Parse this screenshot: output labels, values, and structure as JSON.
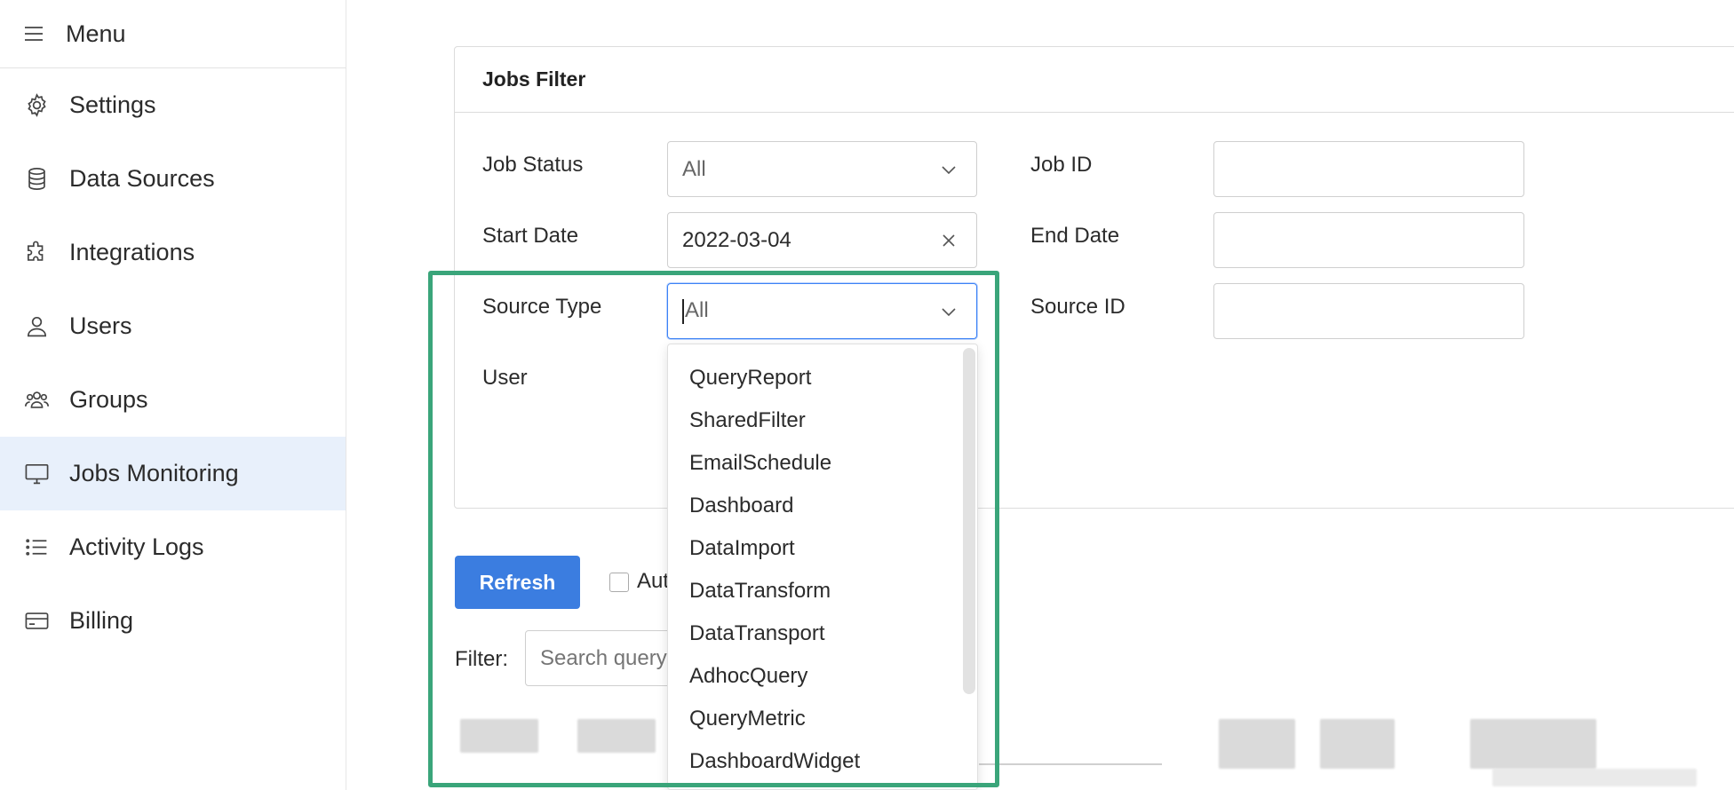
{
  "sidebar": {
    "menu_title": "Menu",
    "items": [
      {
        "label": "Settings",
        "icon": "gear-icon"
      },
      {
        "label": "Data Sources",
        "icon": "database-icon"
      },
      {
        "label": "Integrations",
        "icon": "puzzle-icon"
      },
      {
        "label": "Users",
        "icon": "user-icon"
      },
      {
        "label": "Groups",
        "icon": "users-group-icon"
      },
      {
        "label": "Jobs Monitoring",
        "icon": "monitor-icon",
        "active": true
      },
      {
        "label": "Activity Logs",
        "icon": "list-icon"
      },
      {
        "label": "Billing",
        "icon": "credit-card-icon"
      }
    ]
  },
  "filter": {
    "title": "Jobs Filter",
    "job_status": {
      "label": "Job Status",
      "value": "All"
    },
    "job_id": {
      "label": "Job ID",
      "value": ""
    },
    "start_date": {
      "label": "Start Date",
      "value": "2022-03-04"
    },
    "end_date": {
      "label": "End Date",
      "value": ""
    },
    "source_type": {
      "label": "Source Type",
      "value": "All"
    },
    "source_id": {
      "label": "Source ID",
      "value": ""
    },
    "user": {
      "label": "User"
    }
  },
  "dropdown": {
    "options": [
      "QueryReport",
      "SharedFilter",
      "EmailSchedule",
      "Dashboard",
      "DataImport",
      "DataTransform",
      "DataTransport",
      "AdhocQuery",
      "QueryMetric",
      "DashboardWidget"
    ]
  },
  "actions": {
    "refresh_label": "Refresh",
    "auto_label": "Aut",
    "filter_label": "Filter:",
    "search_placeholder": "Search query"
  },
  "colors": {
    "accent": "#3b7de0",
    "highlight": "#3aa57a",
    "active_nav": "#e8f0fb"
  }
}
